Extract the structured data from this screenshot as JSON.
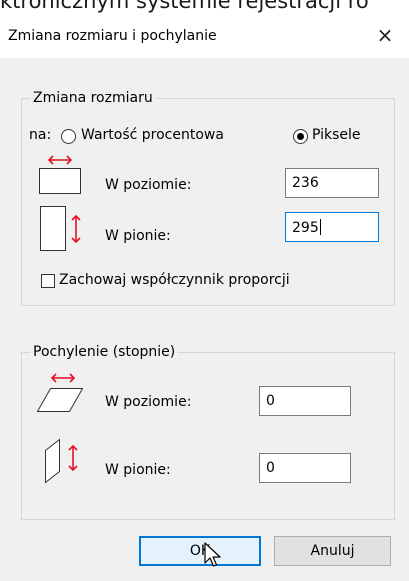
{
  "background_text": "ktronicznym systemie rejestracji ro",
  "dialog": {
    "title": "Zmiana rozmiaru i pochylanie",
    "close_glyph": "×"
  },
  "resize": {
    "legend": "Zmiana rozmiaru",
    "by_label": "na:",
    "option_percent": "Wartość procentowa",
    "option_pixels": "Piksele",
    "selected": "Piksele",
    "horizontal_label": "W poziomie:",
    "horizontal_value": "236",
    "vertical_label": "W pionie:",
    "vertical_value": "295",
    "keep_ratio_label": "Zachowaj współczynnik proporcji",
    "keep_ratio_checked": false
  },
  "skew": {
    "legend": "Pochylenie (stopnie)",
    "horizontal_label": "W poziomie:",
    "horizontal_value": "0",
    "vertical_label": "W pionie:",
    "vertical_value": "0"
  },
  "buttons": {
    "ok": "OK",
    "cancel": "Anuluj"
  },
  "icons": {
    "resize_horizontal": "resize-horizontal-icon",
    "resize_vertical": "resize-vertical-icon",
    "skew_horizontal": "skew-horizontal-icon",
    "skew_vertical": "skew-vertical-icon",
    "cursor": "mouse-pointer-icon"
  },
  "colors": {
    "accent": "#0078d7",
    "arrow": "#e81123",
    "panel": "#f0f0f0"
  }
}
